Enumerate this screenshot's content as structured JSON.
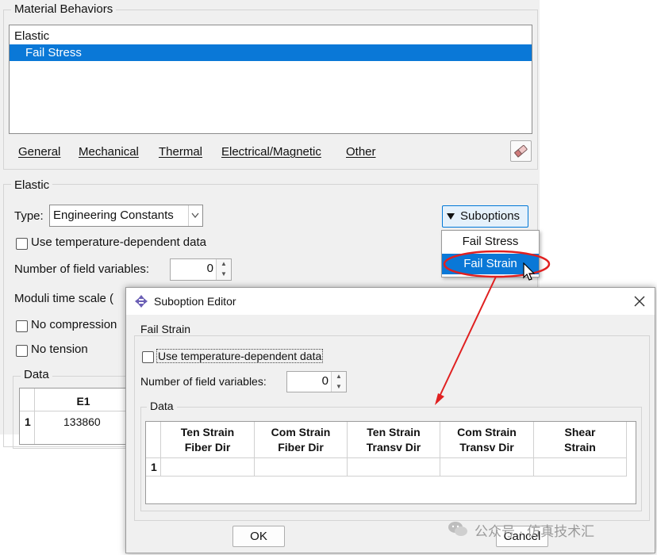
{
  "material_behaviors": {
    "title": "Material Behaviors",
    "items": [
      {
        "label": "Elastic",
        "selected": false
      },
      {
        "label": "Fail Stress",
        "selected": true
      }
    ]
  },
  "menu": {
    "general": "General",
    "mechanical": "Mechanical",
    "thermal": "Thermal",
    "electrical": "Electrical/Magnetic",
    "other": "Other"
  },
  "elastic": {
    "title": "Elastic",
    "type_label": "Type:",
    "type_value": "Engineering Constants",
    "suboptions_label": "Suboptions",
    "use_temp_label": "Use temperature-dependent data",
    "num_field_label": "Number of field variables:",
    "num_field_value": "0",
    "moduli_label": "Moduli time scale (",
    "no_compression_label": "No compression",
    "no_tension_label": "No tension",
    "data_title": "Data",
    "table": {
      "header": "E1",
      "row_index": "1",
      "row_value": "133860"
    }
  },
  "suboptions_menu": {
    "items": [
      "Fail Stress",
      "Fail Strain"
    ],
    "highlighted": "Fail Strain"
  },
  "dialog": {
    "title": "Suboption Editor",
    "group_title": "Fail Strain",
    "use_temp_label": "Use temperature-dependent data",
    "num_field_label": "Number of field variables:",
    "num_field_value": "0",
    "data_title": "Data",
    "columns": [
      {
        "line1": "Ten Strain",
        "line2": "Fiber Dir"
      },
      {
        "line1": "Com Strain",
        "line2": "Fiber Dir"
      },
      {
        "line1": "Ten Strain",
        "line2": "Transv Dir"
      },
      {
        "line1": "Com Strain",
        "line2": "Transv Dir"
      },
      {
        "line1": "Shear",
        "line2": "Strain"
      }
    ],
    "row_index": "1",
    "ok_label": "OK",
    "cancel_label": "Cancel"
  },
  "watermark": "公众号 · 仿真技术汇",
  "colors": {
    "selection": "#0a78d7",
    "annotation": "#e02020"
  }
}
